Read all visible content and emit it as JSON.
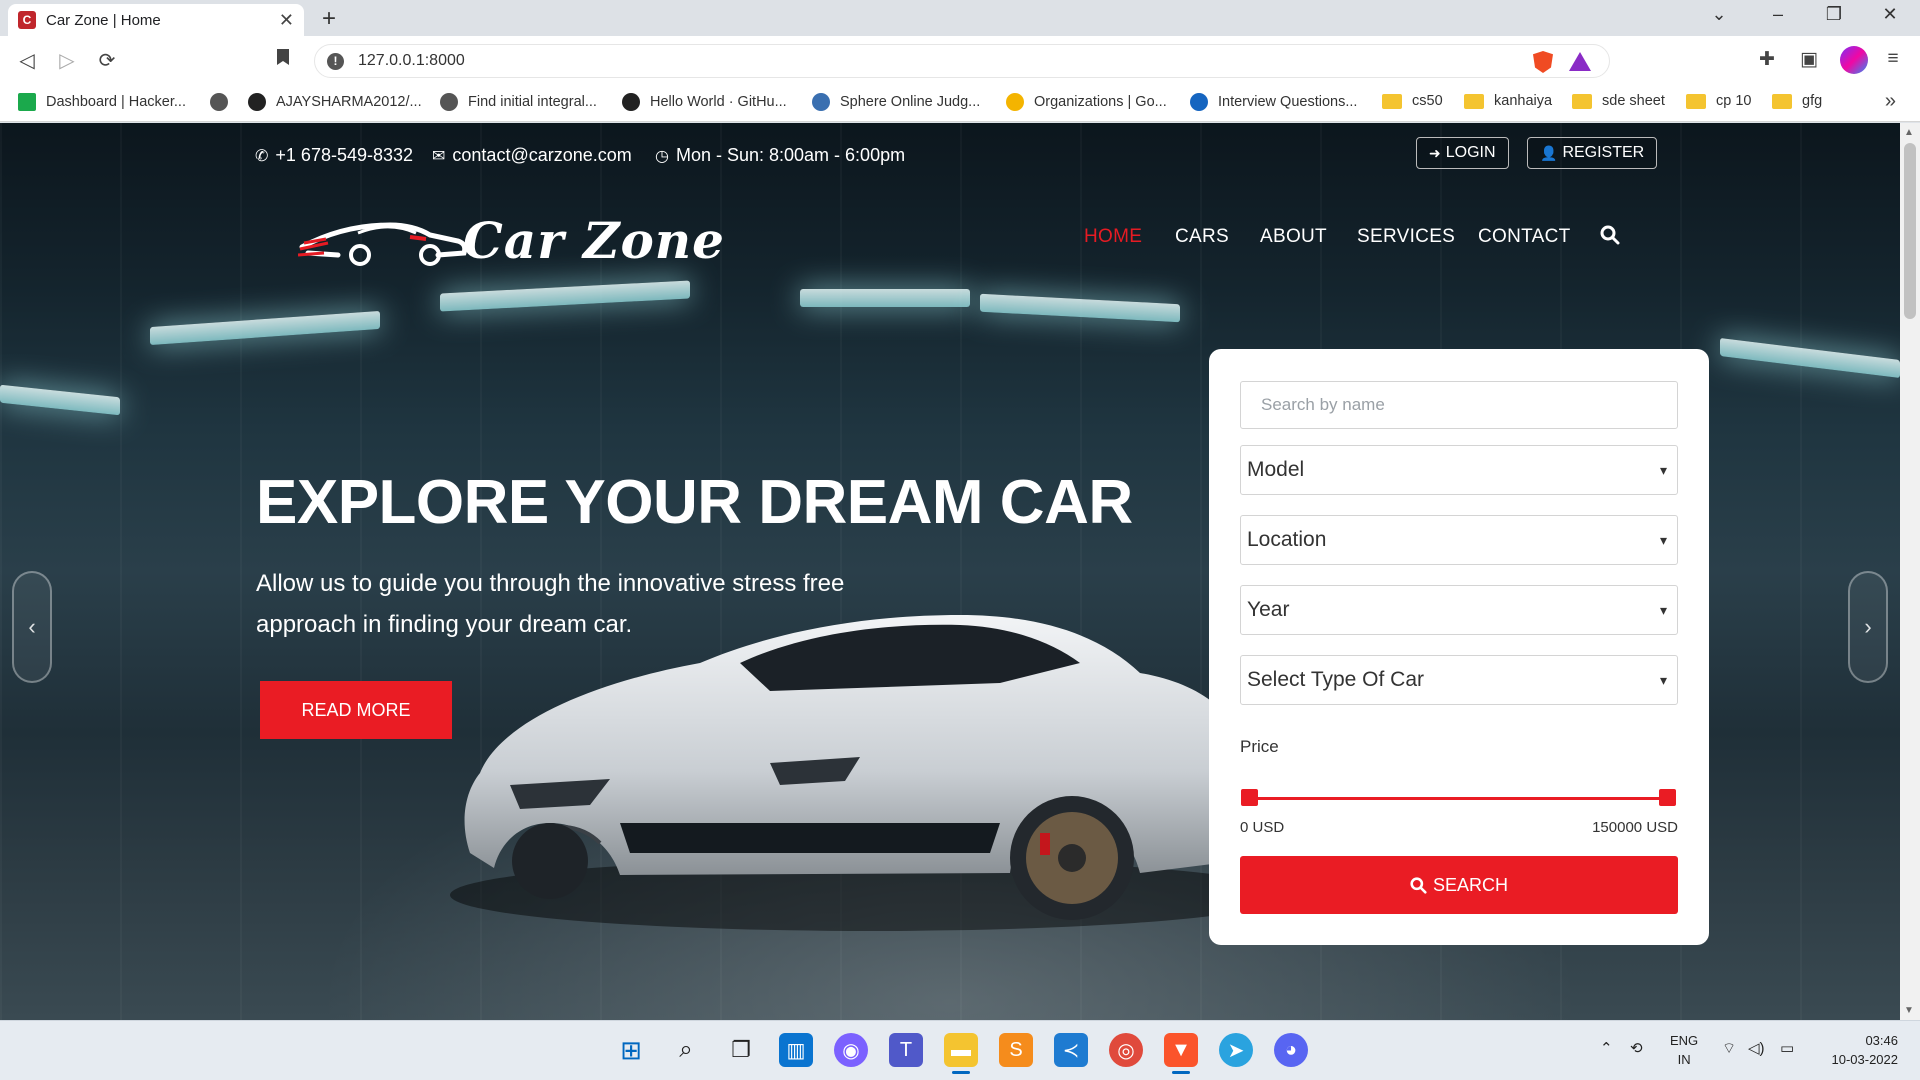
{
  "browser": {
    "tab_title": "Car Zone | Home",
    "favicon_letter": "C",
    "url": "127.0.0.1:8000",
    "bookmarks": [
      {
        "label": "Dashboard | Hacker...",
        "icon": "hackerrank-icon",
        "color": "#1ba94c"
      },
      {
        "label": "",
        "icon": "globe-icon",
        "color": "#555555"
      },
      {
        "label": "AJAYSHARMA2012/...",
        "icon": "github-icon",
        "color": "#222222"
      },
      {
        "label": "Find initial integral...",
        "icon": "globe-icon",
        "color": "#555555"
      },
      {
        "label": "Hello World · GitHu...",
        "icon": "github-icon",
        "color": "#222222"
      },
      {
        "label": "Sphere Online Judg...",
        "icon": "spoj-icon",
        "color": "#3a6fb0"
      },
      {
        "label": "Organizations | Go...",
        "icon": "sun-icon",
        "color": "#f4b400"
      },
      {
        "label": "Interview Questions...",
        "icon": "c-icon",
        "color": "#1565c0"
      },
      {
        "label": "cs50",
        "icon": "folder-icon",
        "color": "#f4c430"
      },
      {
        "label": "kanhaiya",
        "icon": "folder-icon",
        "color": "#f4c430"
      },
      {
        "label": "sde sheet",
        "icon": "folder-icon",
        "color": "#f4c430"
      },
      {
        "label": "cp 10",
        "icon": "folder-icon",
        "color": "#f4c430"
      },
      {
        "label": "gfg",
        "icon": "folder-icon",
        "color": "#f4c430"
      }
    ]
  },
  "site": {
    "phone": "+1 678-549-8332",
    "email": "contact@carzone.com",
    "hours": "Mon - Sun: 8:00am - 6:00pm",
    "login": "LOGIN",
    "register": "REGISTER",
    "logo_text": "Car Zone",
    "nav": [
      "HOME",
      "CARS",
      "ABOUT",
      "SERVICES",
      "CONTACT"
    ],
    "active_nav": "HOME",
    "accent": "#ea1c24"
  },
  "hero": {
    "title": "EXPLORE YOUR DREAM CAR",
    "subtitle": "Allow us to guide you through the innovative stress free approach in finding your dream car.",
    "cta": "READ MORE"
  },
  "search": {
    "name_placeholder": "Search by name",
    "model": "Model",
    "location": "Location",
    "year": "Year",
    "type": "Select Type Of Car",
    "price_label": "Price",
    "price_min": "0 USD",
    "price_max": "150000 USD",
    "price_range_min_fraction": 0,
    "price_range_max_fraction": 1,
    "button": "SEARCH"
  },
  "taskbar": {
    "lang_top": "ENG",
    "lang_bottom": "IN",
    "time": "03:46",
    "date": "10-03-2022"
  }
}
